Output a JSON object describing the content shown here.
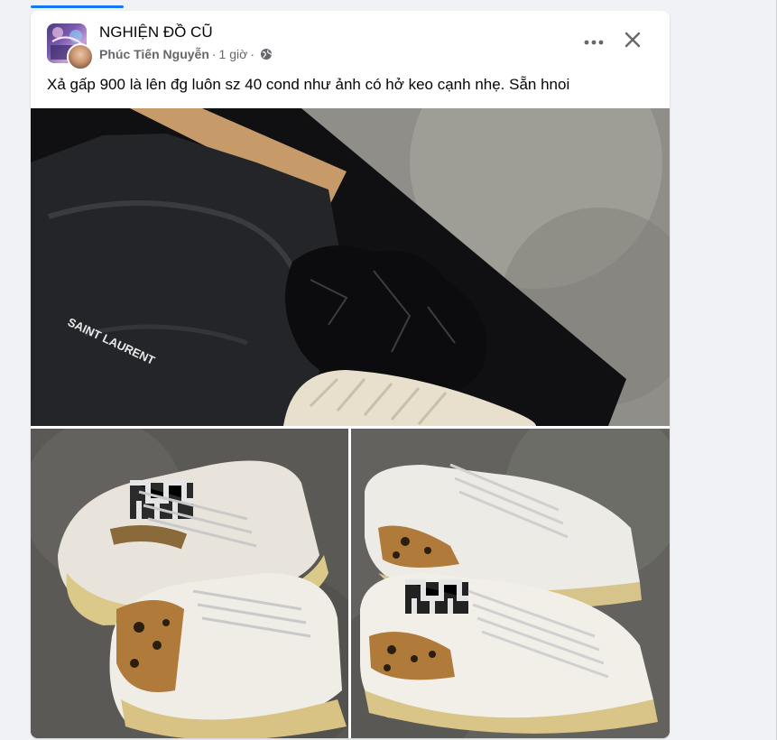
{
  "post": {
    "group_name": "NGHIỆN ĐỒ CŨ",
    "author": "Phúc Tiến Nguyễn",
    "separator": "·",
    "time": "1 giờ",
    "text": "Xả gấp 900 là lên đg luôn sz 40 cond như ảnh có hở keo cạnh nhẹ. Sẵn hnoi"
  },
  "icons": {
    "privacy": "globe-icon",
    "more": "more-horizontal-icon",
    "close": "close-icon"
  },
  "photos": {
    "brand_print": "SAINT LAURENT",
    "items": [
      {
        "name": "box-dustbag-photo",
        "description_visible": false
      },
      {
        "name": "sneakers-pair-photo-left",
        "description_visible": false
      },
      {
        "name": "sneakers-pair-photo-right",
        "description_visible": false
      }
    ]
  },
  "colors": {
    "accent": "#1877f2",
    "text_primary": "#050505",
    "text_secondary": "#65676b"
  }
}
